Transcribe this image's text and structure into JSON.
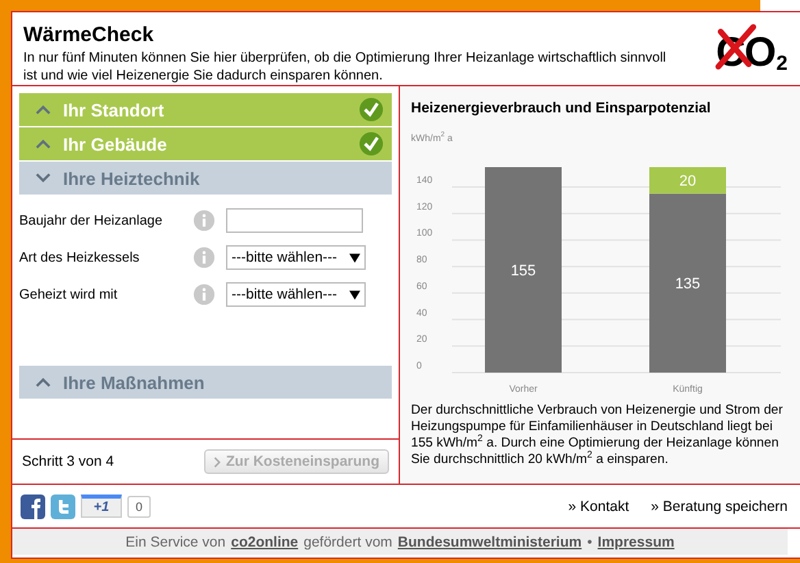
{
  "header": {
    "title": "WärmeCheck",
    "intro": "In nur fünf Minuten können Sie hier überprüfen, ob die Optimierung Ihrer Heizanlage wirtschaftlich sinnvoll ist und wie viel Heizenergie Sie dadurch einsparen können.",
    "logo": "CO",
    "logo_sub": "2"
  },
  "sections": [
    {
      "label": "Ihr Standort",
      "expanded": false,
      "done": true
    },
    {
      "label": "Ihr Gebäude",
      "expanded": false,
      "done": true
    },
    {
      "label": "Ihre Heiztechnik",
      "expanded": true,
      "done": false,
      "fields": [
        {
          "kind": "text",
          "label": "Baujahr der Heizanlage"
        },
        {
          "kind": "select",
          "label": "Art des Heizkessels",
          "value": "---bitte wählen---"
        },
        {
          "kind": "select",
          "label": "Geheizt wird mit",
          "value": "---bitte wählen---"
        }
      ]
    },
    {
      "label": "Ihre Maßnahmen",
      "expanded": false,
      "done": false
    }
  ],
  "step": "Schritt 3 von 4",
  "next_button": {
    "label": "Zur Kosteneinsparung",
    "disabled": true
  },
  "chart": {
    "title": "Heizenergieverbrauch und Einsparpotenzial",
    "chart_data": {
      "type": "bar",
      "ylabel": "kWh/m$^{2}$ a",
      "categories": [
        "Vorher",
        "Künftig"
      ],
      "stacked": true,
      "grid": true,
      "data_labels": true,
      "ylim": [
        0,
        155
      ],
      "yticks": [
        0,
        20,
        40,
        60,
        80,
        100,
        120,
        140
      ],
      "series": [
        {
          "color": "#747474",
          "values": [
            155,
            135
          ]
        },
        {
          "color": "#a6c84c",
          "values": [
            null,
            20
          ]
        }
      ]
    }
  },
  "description": "Der durchschnittliche Verbrauch von Heizenergie und Strom der Heizungspumpe für Einfamilienhäuser in Deutschland liegt bei 155 kWh/m$^{2}$ a. Durch eine Optimierung der Heizanlage können Sie durchschnittlich 20 kWh/m$^{2}$ a einsparen.",
  "social": {
    "plus_label": "+1",
    "count": "0"
  },
  "links": [
    "» Kontakt",
    "» Beratung speichern"
  ],
  "footer": [
    {
      "kind": "text",
      "text": "Ein Service von"
    },
    {
      "kind": "link",
      "text": "co2online"
    },
    {
      "kind": "text",
      "text": "gefördert vom"
    },
    {
      "kind": "link",
      "text": "Bundesumweltministerium"
    },
    {
      "kind": "text",
      "text": "•"
    },
    {
      "kind": "link",
      "text": "Impressum"
    }
  ]
}
